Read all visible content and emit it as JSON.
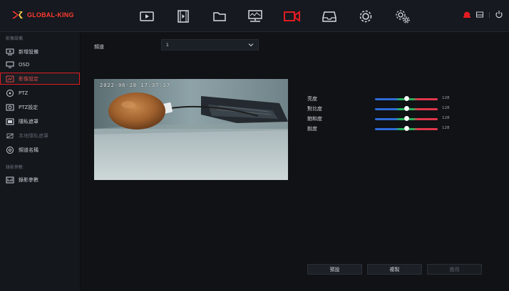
{
  "brand": {
    "name": "GLOBAL-KING",
    "color": "#ff3b30"
  },
  "topnav": {
    "items": [
      {
        "name": "playback",
        "icon": "play-icon"
      },
      {
        "name": "film",
        "icon": "film-icon"
      },
      {
        "name": "folder",
        "icon": "folder-icon"
      },
      {
        "name": "network",
        "icon": "network-icon"
      },
      {
        "name": "camera",
        "icon": "camera-icon",
        "active": true
      },
      {
        "name": "storage",
        "icon": "storage-icon"
      },
      {
        "name": "system",
        "icon": "gear-icon"
      },
      {
        "name": "maintenance",
        "icon": "maintenance-icon"
      }
    ],
    "active_color": "#e11b22"
  },
  "sidebar": {
    "section1": "影像設備",
    "items": [
      {
        "label": "新增設備",
        "icon": "add-device-icon"
      },
      {
        "label": "OSD",
        "icon": "osd-icon"
      },
      {
        "label": "影像設定",
        "icon": "image-settings-icon",
        "active": true
      },
      {
        "label": "PTZ",
        "icon": "ptz-icon"
      },
      {
        "label": "PTZ設定",
        "icon": "ptz-settings-icon"
      },
      {
        "label": "隱私遮罩",
        "icon": "privacy-mask-icon"
      },
      {
        "label": "本地隱私遮罩",
        "icon": "local-privacy-mask-icon",
        "disabled": true
      },
      {
        "label": "頻道名稱",
        "icon": "channel-name-icon"
      }
    ],
    "section2": "錄影參數",
    "items2": [
      {
        "label": "錄影參數",
        "icon": "record-params-icon"
      }
    ]
  },
  "main": {
    "channel_label": "頻道",
    "channel_value": "1",
    "osd_time": "2022-06-28 17:37:17",
    "sliders": [
      {
        "label": "亮度",
        "value": "128",
        "level": 0.5
      },
      {
        "label": "對比度",
        "value": "128",
        "level": 0.5
      },
      {
        "label": "飽和度",
        "value": "128",
        "level": 0.5
      },
      {
        "label": "銳度",
        "value": "128",
        "level": 0.5
      }
    ],
    "buttons": {
      "default": "預設",
      "copy": "複製",
      "apply": "應用"
    }
  }
}
